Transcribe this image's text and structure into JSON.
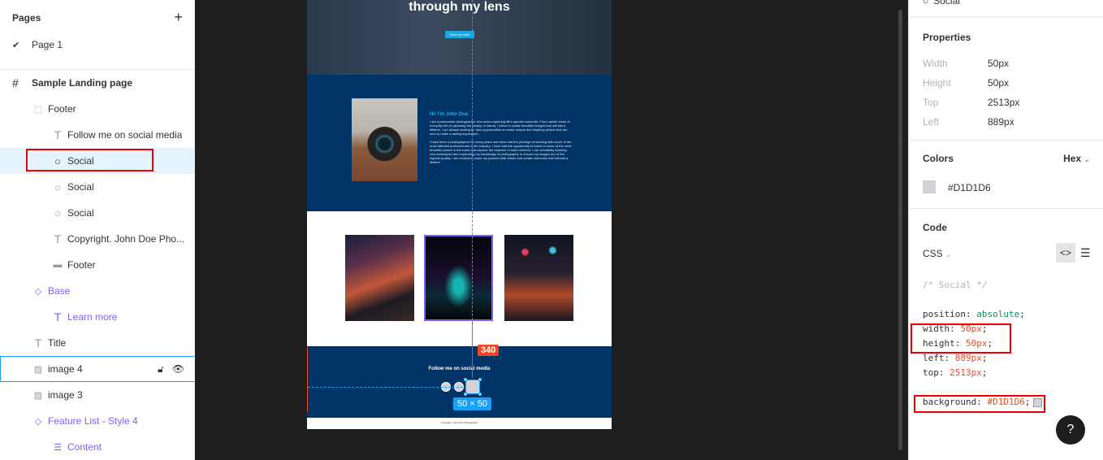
{
  "left_panel": {
    "pages_title": "Pages",
    "add_icon": "plus-icon",
    "page_name": "Page 1",
    "frame_name": "Sample Landing page",
    "layers": [
      {
        "label": "Footer",
        "icon": "frame-icon"
      },
      {
        "label": "Follow me on social media",
        "icon": "text-icon"
      },
      {
        "label": "Social",
        "icon": "ellipse-icon"
      },
      {
        "label": "Social",
        "icon": "ellipse-icon"
      },
      {
        "label": "Social",
        "icon": "ellipse-icon"
      },
      {
        "label": "Copyright. John Doe Pho...",
        "icon": "text-icon"
      },
      {
        "label": "Footer",
        "icon": "rectangle-icon"
      },
      {
        "label": "Base",
        "icon": "component-icon"
      },
      {
        "label": "Learn more",
        "icon": "text-icon"
      },
      {
        "label": "Title",
        "icon": "text-icon"
      },
      {
        "label": "image 4",
        "icon": "image-icon"
      },
      {
        "label": "image 3",
        "icon": "image-icon"
      },
      {
        "label": "Feature List - Style 4",
        "icon": "component-icon"
      },
      {
        "label": "Content",
        "icon": "list-icon"
      }
    ]
  },
  "canvas": {
    "hero_title": "through my lens",
    "hero_button": "View my work",
    "about_heading": "Hi! I'm John Doe.",
    "about_paragraph_1": "I am a passionate photographer who loves capturing life's special moments. From candid shots of everyday life to capturing the beauty of nature, I strive to create beautiful images that will last a lifetime. I am always looking for new opportunities to create unique and inspiring photos that are sure to make a lasting impression.",
    "about_paragraph_2": "I have been a photographer for many years and have had the privilege of working with some of the most talented professionals in the industry. I have had the opportunity to travel to some of the most beautiful places in the world and capture the essence of each moment. I am constantly learning new techniques and expanding my knowledge of photography to ensure my images are of the highest quality. I am excited to share my passion with others and create memories that will last a lifetime.",
    "follow_text": "Follow me on social media",
    "copyright": "Copyright. John Doe Photography",
    "measure_label": "340",
    "size_label": "50 × 50"
  },
  "right_panel": {
    "layer_name": "Social",
    "properties_title": "Properties",
    "properties": [
      {
        "label": "Width",
        "value": "50px"
      },
      {
        "label": "Height",
        "value": "50px"
      },
      {
        "label": "Top",
        "value": "2513px"
      },
      {
        "label": "Left",
        "value": "889px"
      }
    ],
    "colors_title": "Colors",
    "color_format": "Hex",
    "color_value": "#D1D1D6",
    "code_title": "Code",
    "code_language": "CSS",
    "code": {
      "comment": "/* Social */",
      "position_prop": "position: ",
      "position_val": "absolute",
      "width_prop": "width: ",
      "width_val": "50px",
      "height_prop": "height: ",
      "height_val": "50px",
      "left_prop": "left: ",
      "left_val": "889px",
      "top_prop": "top: ",
      "top_val": "2513px",
      "bg_prop": "background: ",
      "bg_val": "#D1D1D6"
    },
    "help_label": "?"
  },
  "colors": {
    "accent": "#18a0fb",
    "measure": "#f24822",
    "swatch": "#d1d1d6",
    "page_blue": "#003366"
  }
}
